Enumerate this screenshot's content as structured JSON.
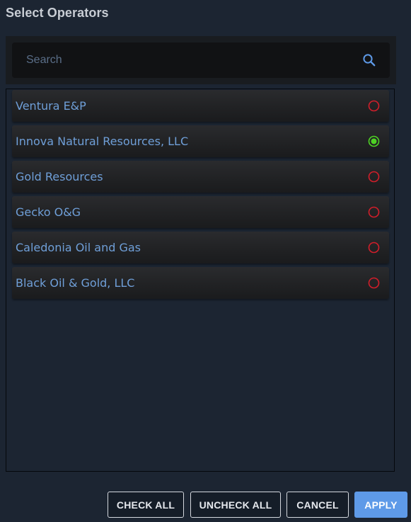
{
  "dialog": {
    "title": "Select Operators"
  },
  "search": {
    "value": "",
    "placeholder": "Search",
    "icon": "search-icon"
  },
  "colors": {
    "background": "#1c2532",
    "label_text": "#6f9fd8",
    "radio_unchecked": "#d11e2a",
    "radio_checked": "#4ed224",
    "apply_button": "#5e9ae8"
  },
  "operators": [
    {
      "label": "Ventura E&P",
      "selected": false
    },
    {
      "label": "Innova Natural Resources, LLC",
      "selected": true
    },
    {
      "label": "Gold Resources",
      "selected": false
    },
    {
      "label": "Gecko O&G",
      "selected": false
    },
    {
      "label": "Caledonia Oil and Gas",
      "selected": false
    },
    {
      "label": "Black Oil & Gold, LLC",
      "selected": false
    }
  ],
  "buttons": {
    "check_all": "CHECK ALL",
    "uncheck_all": "UNCHECK ALL",
    "cancel": "CANCEL",
    "apply": "APPLY"
  }
}
